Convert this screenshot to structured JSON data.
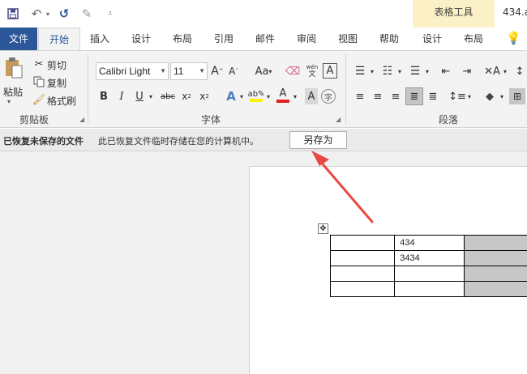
{
  "titlebar": {
    "context_group": "表格工具",
    "doc_title": "434.a",
    "qat_icons": [
      "save-icon",
      "undo-icon",
      "redo-icon",
      "format-painter-icon",
      "customize-icon"
    ]
  },
  "tabs": {
    "file": "文件",
    "home": "开始",
    "insert": "插入",
    "design": "设计",
    "layout": "布局",
    "references": "引用",
    "mailings": "邮件",
    "review": "审阅",
    "view": "视图",
    "help": "帮助",
    "table_design": "设计",
    "table_layout": "布局"
  },
  "ribbon": {
    "clipboard": {
      "label": "剪贴板",
      "paste": "粘贴",
      "cut": "剪切",
      "copy": "复制",
      "format_painter": "格式刷"
    },
    "font": {
      "label": "字体",
      "font_name": "Calibri Light",
      "font_size": "11"
    },
    "paragraph": {
      "label": "段落"
    }
  },
  "recovery_bar": {
    "title": "已恢复未保存的文件",
    "message": "此已恢复文件临时存储在您的计算机中。",
    "save_as": "另存为"
  },
  "document": {
    "table_rows": [
      [
        "",
        "434",
        ""
      ],
      [
        "",
        "3434",
        ""
      ],
      [
        "",
        "",
        ""
      ],
      [
        "",
        "",
        ""
      ]
    ]
  },
  "colors": {
    "accent": "#2b579a",
    "context_tab": "#fbf0c6",
    "arrow": "#e8483f"
  }
}
